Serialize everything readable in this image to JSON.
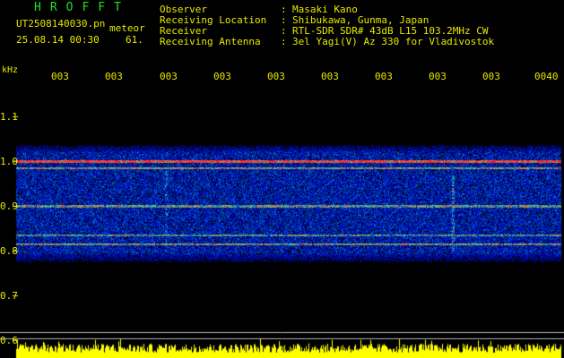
{
  "header": {
    "logo": "HROFFT",
    "filename": "UT2508140030.pn",
    "meteor_label": "meteor",
    "date_time": "25.08.14 00:30",
    "count": "61.",
    "info": [
      {
        "key": "Observer",
        "value": "Masaki Kano"
      },
      {
        "key": "Receiving Location",
        "value": "Shibukawa, Gunma, Japan"
      },
      {
        "key": "Receiver",
        "value": "RTL-SDR SDR# 43dB L15 103.2MHz CW"
      },
      {
        "key": "Receiving Antenna",
        "value": "3el Yagi(V) Az 330 for Vladivostok"
      }
    ]
  },
  "axis": {
    "unit": "kHz",
    "y_labels": [
      "1.1",
      "1.0",
      "0.9",
      "0.8",
      "0.7",
      "0.6"
    ],
    "time_labels": [
      "003",
      "003",
      "003",
      "003",
      "003",
      "003",
      "003",
      "003",
      "003",
      "0040"
    ]
  },
  "colors": {
    "text": "#e8e800",
    "logo": "#22e022",
    "background": "#000000",
    "grid": "#c8c8c8"
  }
}
